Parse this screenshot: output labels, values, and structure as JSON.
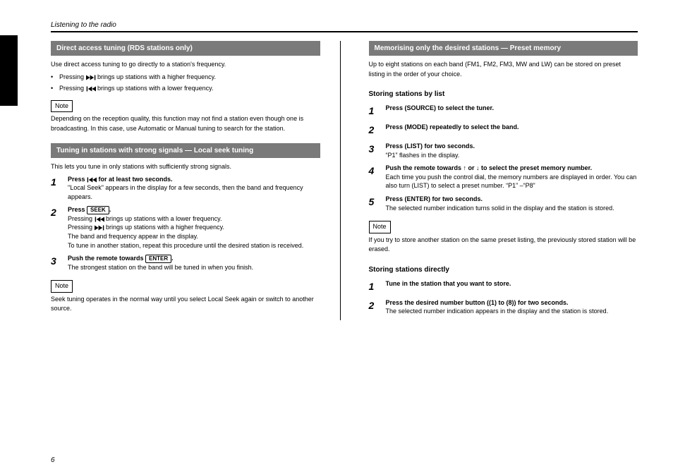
{
  "header": "Listening to the radio",
  "left": {
    "section1": {
      "bar": "Direct access tuning (RDS stations only)",
      "intro": "Use direct access tuning to go directly to a station's frequency.",
      "b1_pre": "Pressing ",
      "b1_post": " brings up stations with a higher frequency.",
      "b2_pre": "Pressing ",
      "b2_post": " brings up stations with a lower frequency.",
      "note": "Note",
      "note_text": "Depending on the reception quality, this function may not find a station even though one is broadcasting. In this case, use Automatic or Manual tuning to search for the station."
    },
    "section2": {
      "bar": "Tuning in stations with strong signals — Local seek tuning",
      "intro": "This lets you tune in only stations with sufficiently strong signals.",
      "step1": {
        "num": "1",
        "title_pre": "Press ",
        "title_post": " for at least two seconds.",
        "desc": "\"Local Seek\" appears in the display for a few seconds, then the band and frequency appears."
      },
      "step2": {
        "num": "2",
        "title_pre": "Press ",
        "title_post": ".",
        "d1_pre": "Pressing ",
        "d1_post": " brings up stations with a lower frequency.",
        "d2_pre": "Pressing ",
        "d2_post": " brings up stations with a higher frequency.",
        "d3": "The band and frequency appear in the display.",
        "d4": "To tune in another station, repeat this procedure until the desired station is received."
      },
      "step3": {
        "num": "3",
        "title_pre": "Push the remote towards ",
        "title_post": ".",
        "desc": "The strongest station on the band will be tuned in when you finish."
      },
      "note": "Note",
      "note_text": "Seek tuning operates in the normal way until you select Local Seek again or switch to another source."
    }
  },
  "right": {
    "bar": "Memorising only the desired stations — Preset memory",
    "intro": "Up to eight stations on each band (FM1, FM2, FM3, MW and LW) can be stored on preset listing in the order of your choice.",
    "sub1": {
      "title": "Storing stations by list",
      "s1": {
        "num": "1",
        "t": "Press (SOURCE) to select the tuner."
      },
      "s2": {
        "num": "2",
        "t": "Press (MODE) repeatedly to select the band."
      },
      "s3": {
        "num": "3",
        "t": "Press (LIST) for two seconds.",
        "d": "“P1” flashes in the display."
      },
      "s4": {
        "num": "4",
        "t_pre": "Push the remote towards ",
        "t_mid": " or ",
        "t_post": " to select the preset memory number.",
        "d": "Each time you push the control dial, the memory numbers are displayed in order. You can also turn (LIST) to select a preset number. “P1” –“P8”"
      },
      "s5": {
        "num": "5",
        "t": "Press (ENTER) for two seconds.",
        "d": "The selected number indication turns solid in the display and the station is stored."
      }
    },
    "note": "Note",
    "note_text": "If you try to store another station on the same preset listing, the previously stored station will be erased.",
    "sub2": {
      "title": "Storing stations directly",
      "s1": {
        "num": "1",
        "t": "Tune in the station that you want to store."
      },
      "s2": {
        "num": "2",
        "t": "Press the desired number button ((1) to (8)) for two seconds.",
        "d": "The selected number indication appears in the display and the station is stored."
      }
    }
  },
  "page_number": "6"
}
